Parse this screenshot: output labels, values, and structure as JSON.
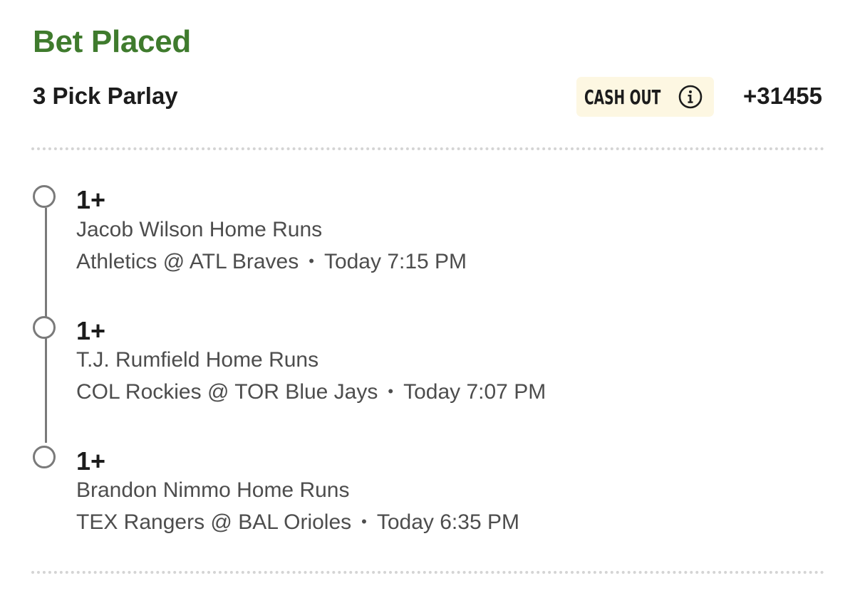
{
  "bet": {
    "status": "Bet Placed",
    "type": "3 Pick Parlay",
    "cash_out_label": "CASH OUT",
    "odds": "+31455"
  },
  "legs": [
    {
      "line": "1+",
      "market": "Jacob Wilson Home Runs",
      "matchup": "Athletics @ ATL Braves",
      "separator": "•",
      "time": "Today 7:15 PM"
    },
    {
      "line": "1+",
      "market": "T.J. Rumfield Home Runs",
      "matchup": "COL Rockies @ TOR Blue Jays",
      "separator": "•",
      "time": "Today 7:07 PM"
    },
    {
      "line": "1+",
      "market": "Brandon Nimmo Home Runs",
      "matchup": "TEX Rangers @ BAL Orioles",
      "separator": "•",
      "time": "Today 6:35 PM"
    }
  ],
  "colors": {
    "status_green": "#3f7b2d",
    "cash_out_bg": "#fdf7e2",
    "timeline_gray": "#7a7a7a"
  },
  "icons": {
    "cash_out_info": "info-circle-icon",
    "leg_marker": "pending-circle-icon"
  }
}
